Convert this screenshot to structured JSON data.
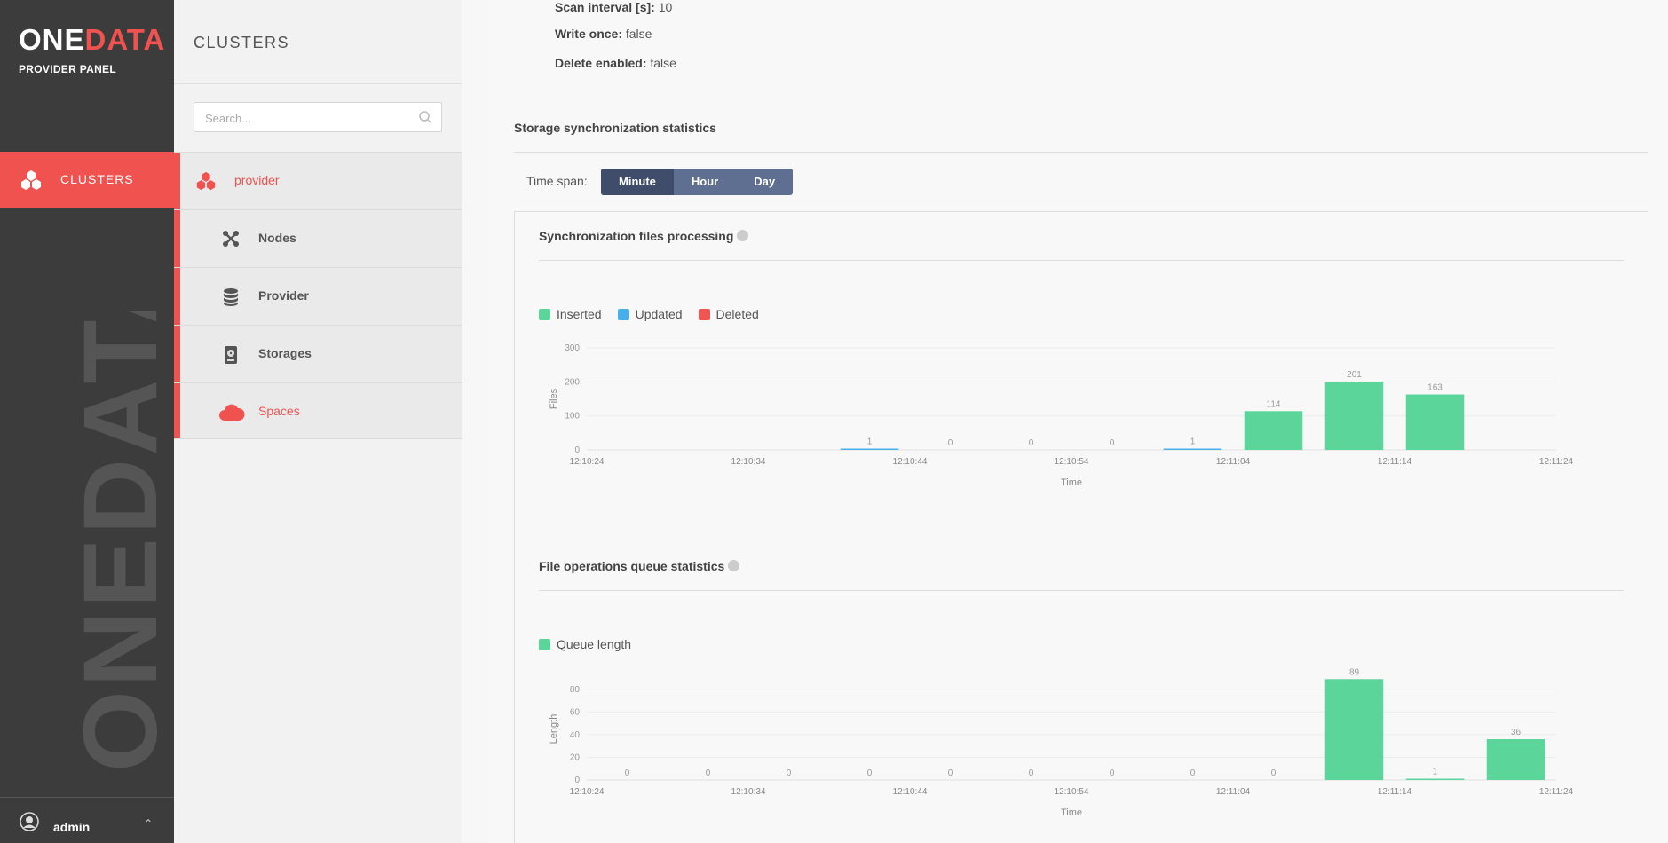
{
  "app": {
    "logo_prefix": "ONE",
    "logo_accent": "DATA",
    "subtitle": "PROVIDER PANEL",
    "watermark": "ONEDATA",
    "nav_clusters_label": "CLUSTERS",
    "user_name": "admin",
    "accent_color": "#f0534f"
  },
  "submenu": {
    "title": "CLUSTERS",
    "search_placeholder": "Search...",
    "cluster_name": "provider",
    "items": [
      {
        "label": "Nodes",
        "icon": "nodes-icon"
      },
      {
        "label": "Provider",
        "icon": "database-icon"
      },
      {
        "label": "Storages",
        "icon": "hard-drive-icon"
      },
      {
        "label": "Spaces",
        "icon": "cloud-icon"
      }
    ]
  },
  "details": {
    "scan_interval_label": "Scan interval [s]:",
    "scan_interval_value": "10",
    "write_once_label": "Write once:",
    "write_once_value": "false",
    "delete_enabled_label": "Delete enabled:",
    "delete_enabled_value": "false"
  },
  "sync_stats": {
    "title": "Storage synchronization statistics",
    "time_span_label": "Time span:",
    "time_span_options": [
      "Minute",
      "Hour",
      "Day"
    ],
    "time_span_selected": "Minute"
  },
  "chart_data": [
    {
      "type": "bar",
      "title": "Synchronization files processing",
      "xlabel": "Time",
      "ylabel": "Files",
      "ylim": [
        0,
        300
      ],
      "yticks": [
        "0",
        "100",
        "200",
        "300"
      ],
      "xticks": [
        "12:10:24",
        "12:10:34",
        "12:10:44",
        "12:10:54",
        "12:11:04",
        "12:11:14",
        "12:11:24"
      ],
      "legend": [
        {
          "name": "Inserted",
          "color": "#5cd59a"
        },
        {
          "name": "Updated",
          "color": "#4aaeea"
        },
        {
          "name": "Deleted",
          "color": "#ef5551"
        }
      ],
      "x": [
        "12:10:44",
        "12:10:49",
        "12:10:54",
        "12:10:59",
        "12:11:04",
        "12:11:09",
        "12:11:14",
        "12:11:19"
      ],
      "values": [
        1,
        0,
        0,
        0,
        1,
        114,
        201,
        163
      ],
      "bar_colors": [
        "#4aaeea",
        "#5cd59a",
        "#5cd59a",
        "#5cd59a",
        "#4aaeea",
        "#5cd59a",
        "#5cd59a",
        "#5cd59a"
      ],
      "grid": true
    },
    {
      "type": "bar",
      "title": "File operations queue statistics",
      "xlabel": "Time",
      "ylabel": "Length",
      "ylim": [
        0,
        90
      ],
      "yticks": [
        "0",
        "20",
        "40",
        "60",
        "80"
      ],
      "xticks": [
        "12:10:24",
        "12:10:34",
        "12:10:44",
        "12:10:54",
        "12:11:04",
        "12:11:14",
        "12:11:24"
      ],
      "legend": [
        {
          "name": "Queue length",
          "color": "#5cd59a"
        }
      ],
      "x": [
        "12:10:29",
        "12:10:34",
        "12:10:39",
        "12:10:44",
        "12:10:49",
        "12:10:54",
        "12:10:59",
        "12:11:04",
        "12:11:09",
        "12:11:14",
        "12:11:19",
        "12:11:24"
      ],
      "values": [
        0,
        0,
        0,
        0,
        0,
        0,
        0,
        0,
        0,
        89,
        1,
        36
      ],
      "bar_colors": [
        "#5cd59a",
        "#5cd59a",
        "#5cd59a",
        "#5cd59a",
        "#5cd59a",
        "#5cd59a",
        "#5cd59a",
        "#5cd59a",
        "#5cd59a",
        "#5cd59a",
        "#5cd59a",
        "#5cd59a"
      ],
      "grid": true
    }
  ]
}
